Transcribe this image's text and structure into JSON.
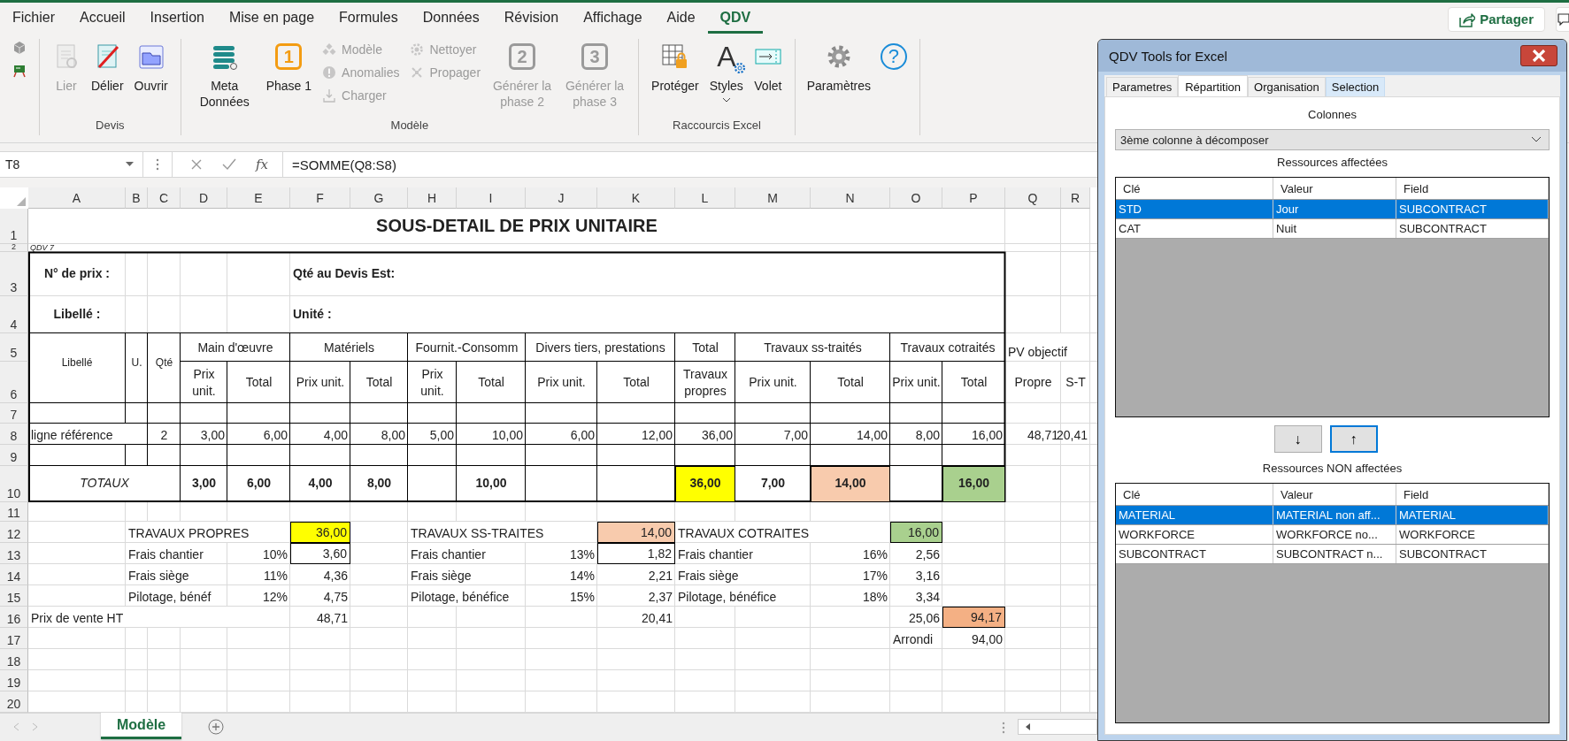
{
  "menu_tabs": [
    {
      "label": "Fichier",
      "selected": false
    },
    {
      "label": "Accueil",
      "selected": false
    },
    {
      "label": "Insertion",
      "selected": false
    },
    {
      "label": "Mise en page",
      "selected": false
    },
    {
      "label": "Formules",
      "selected": false
    },
    {
      "label": "Données",
      "selected": false
    },
    {
      "label": "Révision",
      "selected": false
    },
    {
      "label": "Affichage",
      "selected": false
    },
    {
      "label": "Aide",
      "selected": false
    },
    {
      "label": "QDV",
      "selected": true
    }
  ],
  "share_button": {
    "label": "Partager"
  },
  "ribbon": {
    "groups": [
      {
        "label": "Devis",
        "items": [
          {
            "kind": "large",
            "label": "Lier",
            "disabled": true
          },
          {
            "kind": "large",
            "label": "Délier",
            "disabled": false
          },
          {
            "kind": "large",
            "label": "Ouvrir",
            "disabled": false
          }
        ]
      },
      {
        "label": "Modèle",
        "items": [
          {
            "kind": "large",
            "label": "Meta Données",
            "disabled": false
          },
          {
            "kind": "large",
            "label": "Phase 1",
            "badge": "1",
            "disabled": false
          },
          {
            "kind": "small",
            "label": "Modèle",
            "disabled": true
          },
          {
            "kind": "small",
            "label": "Anomalies",
            "disabled": true
          },
          {
            "kind": "small",
            "label": "Charger",
            "disabled": true
          },
          {
            "kind": "small",
            "label": "Nettoyer",
            "disabled": true
          },
          {
            "kind": "small",
            "label": "Propager",
            "disabled": true
          },
          {
            "kind": "large",
            "label": "Générer la phase 2",
            "badge": "2",
            "disabled": true
          },
          {
            "kind": "large",
            "label": "Générer la phase 3",
            "badge": "3",
            "disabled": true
          }
        ]
      },
      {
        "label": "Raccourcis Excel",
        "items": [
          {
            "kind": "large",
            "label": "Protéger",
            "disabled": false
          },
          {
            "kind": "large",
            "label": "Styles",
            "badge": "A",
            "disabled": false
          },
          {
            "kind": "large",
            "label": "Volet",
            "disabled": false
          }
        ]
      },
      {
        "items": [
          {
            "kind": "large",
            "label": "Paramètres",
            "disabled": false
          },
          {
            "kind": "large",
            "badge": "?",
            "disabled": false
          }
        ]
      }
    ]
  },
  "formula_bar": {
    "name_box": "T8",
    "function_label": "fx",
    "formula": "=SOMME(Q8:S8)"
  },
  "sheet": {
    "columns": [
      "A",
      "B",
      "C",
      "D",
      "E",
      "F",
      "G",
      "H",
      "I",
      "J",
      "K",
      "L",
      "M",
      "N",
      "O",
      "P",
      "Q",
      "R"
    ],
    "rows": [
      {
        "number": "1",
        "cells": [
          {
            "text": "SOUS-DETAIL DE PRIX UNITAIRE",
            "kind": "title"
          }
        ]
      },
      {
        "number": "2",
        "cells": [
          {
            "text": "QDV 7",
            "kind": "note"
          }
        ]
      },
      {
        "number": "3",
        "cells": [
          {
            "text": "N° de prix :",
            "kind": "label-center"
          },
          null,
          null,
          null,
          null,
          {
            "text": "Qté au Devis Est:",
            "kind": "label"
          }
        ]
      },
      {
        "number": "4",
        "cells": [
          {
            "text": "Libellé :",
            "kind": "label-center"
          },
          null,
          null,
          null,
          null,
          {
            "text": "Unité :",
            "kind": "label"
          }
        ]
      },
      {
        "number": "5",
        "cells": [
          {
            "text": "Libellé",
            "kind": "tall"
          },
          {
            "text": "U.",
            "kind": "tall"
          },
          {
            "text": "Qté",
            "kind": "tall"
          },
          {
            "text": "Main d'œuvre",
            "kind": "head"
          },
          null,
          {
            "text": "Matériels",
            "kind": "head"
          },
          null,
          {
            "text": "Fournit.-Consomm",
            "kind": "head"
          },
          null,
          {
            "text": "Divers tiers, prestations",
            "kind": "head"
          },
          null,
          {
            "text": "Total",
            "kind": "head"
          },
          {
            "text": "Travaux ss-traités",
            "kind": "head"
          },
          null,
          {
            "text": "Travaux cotraités",
            "kind": "head"
          },
          null,
          {
            "text": "PV objectif",
            "kind": "text"
          }
        ]
      },
      {
        "number": "6",
        "cells": [
          null,
          null,
          null,
          {
            "text": "Prix unit.",
            "kind": "head"
          },
          {
            "text": "Total",
            "kind": "head"
          },
          {
            "text": "Prix unit.",
            "kind": "head"
          },
          {
            "text": "Total",
            "kind": "head"
          },
          {
            "text": "Prix unit.",
            "kind": "head"
          },
          {
            "text": "Total",
            "kind": "head"
          },
          {
            "text": "Prix unit.",
            "kind": "head"
          },
          {
            "text": "Total",
            "kind": "head"
          },
          {
            "text": "Travaux propres",
            "kind": "head"
          },
          {
            "text": "Prix unit.",
            "kind": "head"
          },
          {
            "text": "Total",
            "kind": "head"
          },
          {
            "text": "Prix unit.",
            "kind": "head"
          },
          {
            "text": "Total",
            "kind": "head"
          },
          {
            "text": "Propre",
            "kind": "head"
          },
          {
            "text": "S-T",
            "kind": "head"
          }
        ]
      },
      {
        "number": "7"
      },
      {
        "number": "8",
        "cells": [
          {
            "text": "ligne référence",
            "kind": "text"
          },
          null,
          {
            "text": "2",
            "kind": "center"
          },
          {
            "text": "3,00",
            "kind": "num"
          },
          {
            "text": "6,00",
            "kind": "num"
          },
          {
            "text": "4,00",
            "kind": "num"
          },
          {
            "text": "8,00",
            "kind": "num"
          },
          {
            "text": "5,00",
            "kind": "num"
          },
          {
            "text": "10,00",
            "kind": "num"
          },
          {
            "text": "6,00",
            "kind": "num"
          },
          {
            "text": "12,00",
            "kind": "num"
          },
          {
            "text": "36,00",
            "kind": "num"
          },
          {
            "text": "7,00",
            "kind": "num"
          },
          {
            "text": "14,00",
            "kind": "num"
          },
          {
            "text": "8,00",
            "kind": "num"
          },
          {
            "text": "16,00",
            "kind": "num"
          },
          {
            "text": "48,71",
            "kind": "num"
          },
          {
            "text": "20,41",
            "kind": "num"
          }
        ]
      },
      {
        "number": "9"
      },
      {
        "number": "10",
        "cells": [
          {
            "text": "TOTAUX",
            "kind": "total-label"
          },
          null,
          null,
          {
            "text": "3,00",
            "kind": "total"
          },
          {
            "text": "6,00",
            "kind": "total"
          },
          {
            "text": "4,00",
            "kind": "total"
          },
          {
            "text": "8,00",
            "kind": "total"
          },
          null,
          {
            "text": "10,00",
            "kind": "total"
          },
          null,
          null,
          {
            "text": "36,00",
            "kind": "total",
            "color": "#ffff00"
          },
          {
            "text": "7,00",
            "kind": "total"
          },
          {
            "text": "14,00",
            "kind": "total",
            "color": "#f8cbad"
          },
          null,
          {
            "text": "16,00",
            "kind": "total",
            "color": "#a9d08e"
          }
        ]
      },
      {
        "number": "11"
      },
      {
        "number": "12",
        "cells": [
          null,
          {
            "text": "TRAVAUX PROPRES",
            "kind": "text"
          },
          null,
          null,
          null,
          {
            "text": "36,00",
            "kind": "num",
            "color": "#ffff00"
          },
          null,
          {
            "text": "TRAVAUX SS-TRAITES",
            "kind": "text"
          },
          null,
          null,
          {
            "text": "14,00",
            "kind": "num",
            "color": "#f8cbad"
          },
          {
            "text": "TRAVAUX COTRAITES",
            "kind": "text"
          },
          null,
          null,
          {
            "text": "16,00",
            "kind": "num",
            "color": "#a9d08e"
          }
        ]
      },
      {
        "number": "13",
        "cells": [
          null,
          {
            "text": "Frais chantier",
            "kind": "text"
          },
          null,
          null,
          {
            "text": "10%",
            "kind": "num"
          },
          {
            "text": "3,60",
            "kind": "boxed-num"
          },
          null,
          {
            "text": "Frais chantier",
            "kind": "text"
          },
          null,
          {
            "text": "13%",
            "kind": "num"
          },
          {
            "text": "1,82",
            "kind": "boxed-num"
          },
          {
            "text": "Frais chantier",
            "kind": "text"
          },
          null,
          {
            "text": "16%",
            "kind": "num"
          },
          {
            "text": "2,56",
            "kind": "num"
          }
        ]
      },
      {
        "number": "14",
        "cells": [
          null,
          {
            "text": "Frais siège",
            "kind": "text"
          },
          null,
          null,
          {
            "text": "11%",
            "kind": "num"
          },
          {
            "text": "4,36",
            "kind": "num"
          },
          null,
          {
            "text": "Frais siège",
            "kind": "text"
          },
          null,
          {
            "text": "14%",
            "kind": "num"
          },
          {
            "text": "2,21",
            "kind": "num"
          },
          {
            "text": "Frais siège",
            "kind": "text"
          },
          null,
          {
            "text": "17%",
            "kind": "num"
          },
          {
            "text": "3,16",
            "kind": "num"
          }
        ]
      },
      {
        "number": "15",
        "cells": [
          null,
          {
            "text": "Pilotage, bénéf",
            "kind": "text"
          },
          null,
          null,
          {
            "text": "12%",
            "kind": "num"
          },
          {
            "text": "4,75",
            "kind": "num"
          },
          null,
          {
            "text": "Pilotage, bénéfice",
            "kind": "text"
          },
          null,
          {
            "text": "15%",
            "kind": "num"
          },
          {
            "text": "2,37",
            "kind": "num"
          },
          {
            "text": "Pilotage, bénéfice",
            "kind": "text"
          },
          null,
          {
            "text": "18%",
            "kind": "num"
          },
          {
            "text": "3,34",
            "kind": "num"
          }
        ]
      },
      {
        "number": "16",
        "cells": [
          {
            "text": "Prix de vente HT",
            "kind": "text"
          },
          null,
          null,
          null,
          null,
          {
            "text": "48,71",
            "kind": "num"
          },
          null,
          null,
          null,
          null,
          {
            "text": "20,41",
            "kind": "num"
          },
          null,
          null,
          null,
          {
            "text": "25,06",
            "kind": "num"
          },
          {
            "text": "94,17",
            "kind": "num",
            "color": "#f4b084"
          }
        ]
      },
      {
        "number": "17",
        "cells": [
          null,
          null,
          null,
          null,
          null,
          null,
          null,
          null,
          null,
          null,
          null,
          null,
          null,
          null,
          {
            "text": "Arrondi",
            "kind": "text"
          },
          {
            "text": "94,00",
            "kind": "num"
          }
        ]
      },
      {
        "number": "18"
      },
      {
        "number": "19"
      },
      {
        "number": "20"
      }
    ]
  },
  "sheet_tabs": [
    {
      "label": "Modèle",
      "selected": true
    }
  ],
  "dialog": {
    "title": "QDV Tools for Excel",
    "tabs": [
      {
        "label": "Parametres",
        "selected": false,
        "highlighted": false
      },
      {
        "label": "Répartition",
        "selected": true,
        "highlighted": false
      },
      {
        "label": "Organisation",
        "selected": false,
        "highlighted": false
      },
      {
        "label": "Selection",
        "selected": false,
        "highlighted": true
      }
    ],
    "columns_label": "Colonnes",
    "column_select": {
      "value": "3ème colonne à décomposer"
    },
    "assigned": {
      "label": "Ressources affectées",
      "columns": [
        "Clé",
        "Valeur",
        "Field"
      ],
      "rows": [
        {
          "cells": [
            "STD",
            "Jour",
            "SUBCONTRACT"
          ],
          "selected": true
        },
        {
          "cells": [
            "CAT",
            "Nuit",
            "SUBCONTRACT"
          ],
          "selected": false
        }
      ]
    },
    "move_buttons": [
      {
        "label": "↓",
        "focused": false
      },
      {
        "label": "↑",
        "focused": true
      }
    ],
    "unassigned": {
      "label": "Ressources NON affectées",
      "columns": [
        "Clé",
        "Valeur",
        "Field"
      ],
      "rows": [
        {
          "cells": [
            "MATERIAL",
            "MATERIAL non aff...",
            "MATERIAL"
          ],
          "selected": true
        },
        {
          "cells": [
            "WORKFORCE",
            "WORKFORCE no...",
            "WORKFORCE"
          ],
          "selected": false
        },
        {
          "cells": [
            "SUBCONTRACT",
            "SUBCONTRACT n...",
            "SUBCONTRACT"
          ],
          "selected": false
        }
      ]
    }
  }
}
